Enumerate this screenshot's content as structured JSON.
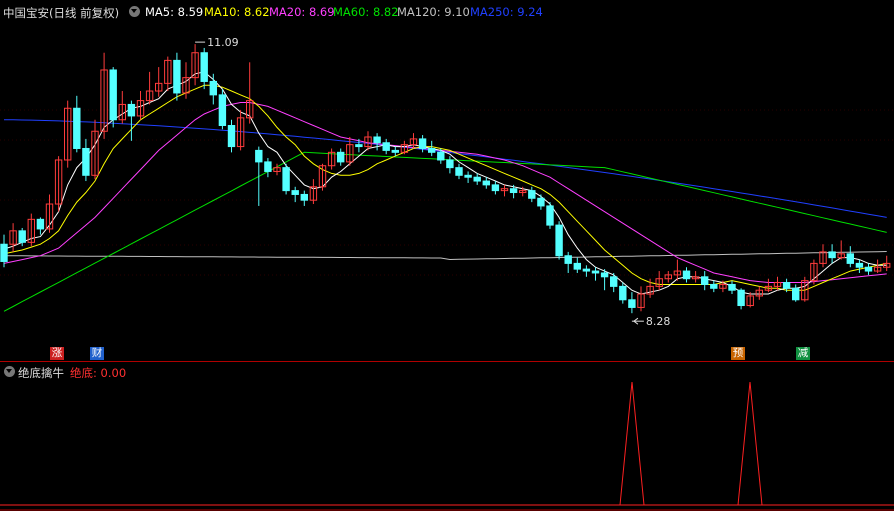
{
  "header": {
    "title": "中国宝安(日线 前复权)",
    "ma": [
      {
        "label": "MA5: 8.59",
        "color": "#ffffff"
      },
      {
        "label": "MA10: 8.62",
        "color": "#ffff00"
      },
      {
        "label": "MA20: 8.69",
        "color": "#ff40ff"
      },
      {
        "label": "MA60: 8.82",
        "color": "#00e000"
      },
      {
        "label": "MA120: 9.10",
        "color": "#c0c0c0"
      },
      {
        "label": "MA250: 9.24",
        "color": "#2040ff"
      }
    ]
  },
  "sub_header": {
    "name": "绝底擒牛",
    "series_label": "绝底: 0.00"
  },
  "tags": [
    {
      "text": "涨",
      "color": "#cc2020"
    },
    {
      "text": "财",
      "color": "#2060cc"
    },
    {
      "text": "预",
      "color": "#c86400"
    },
    {
      "text": "减",
      "color": "#109040"
    }
  ],
  "colors": {
    "up": "#ff3c3c",
    "down": "#54ffff",
    "axis": "#b00000",
    "grid": "#5a0000",
    "signal": "#ff2020"
  },
  "chart_data": {
    "type": "candlestick",
    "title": "中国宝安(日线 前复权)",
    "annotations": [
      {
        "text": "11.09",
        "type": "high"
      },
      {
        "text": "8.28",
        "type": "low"
      }
    ],
    "ylim": [
      8.0,
      11.3
    ],
    "candles": [
      [
        9.0,
        8.82,
        9.1,
        8.76
      ],
      [
        9.0,
        9.14,
        9.22,
        8.92
      ],
      [
        9.14,
        9.02,
        9.17,
        8.98
      ],
      [
        9.02,
        9.26,
        9.32,
        8.98
      ],
      [
        9.26,
        9.16,
        9.28,
        9.1
      ],
      [
        9.16,
        9.42,
        9.52,
        9.12
      ],
      [
        9.42,
        9.88,
        9.92,
        9.34
      ],
      [
        9.88,
        10.42,
        10.5,
        9.8
      ],
      [
        10.42,
        10.0,
        10.55,
        9.96
      ],
      [
        10.0,
        9.72,
        10.1,
        9.66
      ],
      [
        9.72,
        10.18,
        10.3,
        9.68
      ],
      [
        10.18,
        10.82,
        11.0,
        10.1
      ],
      [
        10.82,
        10.3,
        10.85,
        10.22
      ],
      [
        10.3,
        10.46,
        10.6,
        10.26
      ],
      [
        10.46,
        10.34,
        10.5,
        10.08
      ],
      [
        10.34,
        10.5,
        10.6,
        10.3
      ],
      [
        10.5,
        10.6,
        10.8,
        10.46
      ],
      [
        10.6,
        10.68,
        10.85,
        10.54
      ],
      [
        10.68,
        10.92,
        10.96,
        10.6
      ],
      [
        10.92,
        10.58,
        11.0,
        10.5
      ],
      [
        10.58,
        10.74,
        10.9,
        10.52
      ],
      [
        10.74,
        11.0,
        11.09,
        10.66
      ],
      [
        11.0,
        10.7,
        11.05,
        10.62
      ],
      [
        10.7,
        10.56,
        10.78,
        10.46
      ],
      [
        10.56,
        10.24,
        10.62,
        10.2
      ],
      [
        10.24,
        10.02,
        10.3,
        9.96
      ],
      [
        10.02,
        10.32,
        10.4,
        9.98
      ],
      [
        10.32,
        10.5,
        10.9,
        10.26
      ],
      [
        9.98,
        9.86,
        10.02,
        9.4
      ],
      [
        9.86,
        9.76,
        9.9,
        9.7
      ],
      [
        9.76,
        9.8,
        9.84,
        9.72
      ],
      [
        9.8,
        9.56,
        9.84,
        9.52
      ],
      [
        9.56,
        9.52,
        9.6,
        9.44
      ],
      [
        9.52,
        9.46,
        9.56,
        9.4
      ],
      [
        9.46,
        9.6,
        9.68,
        9.42
      ],
      [
        9.6,
        9.82,
        9.84,
        9.56
      ],
      [
        9.82,
        9.96,
        10.0,
        9.78
      ],
      [
        9.96,
        9.86,
        10.0,
        9.82
      ],
      [
        9.86,
        10.04,
        10.12,
        9.82
      ],
      [
        10.04,
        10.02,
        10.1,
        9.96
      ],
      [
        10.02,
        10.12,
        10.18,
        9.98
      ],
      [
        10.12,
        10.06,
        10.16,
        9.98
      ],
      [
        10.06,
        9.98,
        10.1,
        9.94
      ],
      [
        9.98,
        9.96,
        10.02,
        9.92
      ],
      [
        9.96,
        10.04,
        10.08,
        9.94
      ],
      [
        10.04,
        10.1,
        10.16,
        10.0
      ],
      [
        10.1,
        10.0,
        10.14,
        9.96
      ],
      [
        10.0,
        9.96,
        10.08,
        9.92
      ],
      [
        9.96,
        9.88,
        10.0,
        9.84
      ],
      [
        9.88,
        9.8,
        9.92,
        9.74
      ],
      [
        9.8,
        9.72,
        9.84,
        9.68
      ],
      [
        9.72,
        9.7,
        9.76,
        9.64
      ],
      [
        9.7,
        9.66,
        9.74,
        9.62
      ],
      [
        9.66,
        9.62,
        9.7,
        9.58
      ],
      [
        9.62,
        9.56,
        9.66,
        9.52
      ],
      [
        9.56,
        9.58,
        9.62,
        9.5
      ],
      [
        9.58,
        9.54,
        9.62,
        9.48
      ],
      [
        9.54,
        9.56,
        9.6,
        9.5
      ],
      [
        9.56,
        9.48,
        9.6,
        9.44
      ],
      [
        9.48,
        9.4,
        9.52,
        9.36
      ],
      [
        9.4,
        9.2,
        9.44,
        9.16
      ],
      [
        9.2,
        8.88,
        9.24,
        8.84
      ],
      [
        8.88,
        8.8,
        8.92,
        8.7
      ],
      [
        8.8,
        8.74,
        8.86,
        8.7
      ],
      [
        8.74,
        8.72,
        8.78,
        8.66
      ],
      [
        8.72,
        8.7,
        8.76,
        8.62
      ],
      [
        8.7,
        8.66,
        8.74,
        8.52
      ],
      [
        8.66,
        8.56,
        8.7,
        8.5
      ],
      [
        8.56,
        8.42,
        8.6,
        8.38
      ],
      [
        8.42,
        8.34,
        8.5,
        8.28
      ],
      [
        8.34,
        8.48,
        8.56,
        8.3
      ],
      [
        8.48,
        8.56,
        8.64,
        8.44
      ],
      [
        8.56,
        8.64,
        8.72,
        8.52
      ],
      [
        8.64,
        8.68,
        8.72,
        8.6
      ],
      [
        8.68,
        8.72,
        8.84,
        8.62
      ],
      [
        8.72,
        8.64,
        8.76,
        8.6
      ],
      [
        8.64,
        8.66,
        8.72,
        8.6
      ],
      [
        8.66,
        8.58,
        8.72,
        8.52
      ],
      [
        8.58,
        8.54,
        8.62,
        8.5
      ],
      [
        8.54,
        8.58,
        8.62,
        8.5
      ],
      [
        8.58,
        8.52,
        8.62,
        8.48
      ],
      [
        8.52,
        8.36,
        8.54,
        8.32
      ],
      [
        8.36,
        8.46,
        8.5,
        8.34
      ],
      [
        8.46,
        8.52,
        8.56,
        8.42
      ],
      [
        8.52,
        8.56,
        8.64,
        8.5
      ],
      [
        8.56,
        8.6,
        8.66,
        8.52
      ],
      [
        8.6,
        8.54,
        8.64,
        8.5
      ],
      [
        8.54,
        8.42,
        8.58,
        8.4
      ],
      [
        8.42,
        8.62,
        8.66,
        8.4
      ],
      [
        8.62,
        8.8,
        8.84,
        8.58
      ],
      [
        8.8,
        8.92,
        9.0,
        8.76
      ],
      [
        8.92,
        8.86,
        9.0,
        8.8
      ],
      [
        8.86,
        8.9,
        9.04,
        8.84
      ],
      [
        8.9,
        8.8,
        8.98,
        8.76
      ],
      [
        8.8,
        8.76,
        8.84,
        8.7
      ],
      [
        8.76,
        8.72,
        8.8,
        8.68
      ],
      [
        8.72,
        8.76,
        8.84,
        8.7
      ],
      [
        8.76,
        8.8,
        8.88,
        8.72
      ]
    ],
    "ma_series": [
      {
        "name": "MA5",
        "color": "#ffffff",
        "values": [
          8.95,
          8.98,
          9.02,
          9.06,
          9.08,
          9.2,
          9.34,
          9.62,
          9.8,
          9.9,
          10.04,
          10.22,
          10.3,
          10.36,
          10.42,
          10.44,
          10.48,
          10.52,
          10.62,
          10.66,
          10.7,
          10.78,
          10.8,
          10.72,
          10.62,
          10.46,
          10.38,
          10.34,
          10.16,
          10.02,
          9.96,
          9.82,
          9.72,
          9.62,
          9.58,
          9.6,
          9.7,
          9.76,
          9.84,
          9.92,
          10.0,
          10.02,
          10.04,
          10.02,
          10.02,
          10.04,
          10.02,
          10.0,
          9.98,
          9.94,
          9.86,
          9.8,
          9.74,
          9.7,
          9.66,
          9.62,
          9.6,
          9.58,
          9.56,
          9.5,
          9.42,
          9.28,
          9.1,
          8.96,
          8.84,
          8.76,
          8.72,
          8.68,
          8.6,
          8.52,
          8.48,
          8.5,
          8.52,
          8.56,
          8.64,
          8.66,
          8.66,
          8.64,
          8.62,
          8.6,
          8.56,
          8.5,
          8.48,
          8.48,
          8.48,
          8.52,
          8.54,
          8.54,
          8.56,
          8.64,
          8.72,
          8.8,
          8.86,
          8.86,
          8.84,
          8.8,
          8.78,
          8.78
        ]
      },
      {
        "name": "MA10",
        "color": "#ffff00",
        "values": [
          8.9,
          8.92,
          8.94,
          8.97,
          9.0,
          9.06,
          9.14,
          9.3,
          9.44,
          9.54,
          9.66,
          9.84,
          10.0,
          10.1,
          10.2,
          10.3,
          10.36,
          10.42,
          10.48,
          10.54,
          10.58,
          10.62,
          10.66,
          10.66,
          10.64,
          10.6,
          10.56,
          10.52,
          10.44,
          10.34,
          10.22,
          10.12,
          10.04,
          9.92,
          9.84,
          9.78,
          9.74,
          9.72,
          9.72,
          9.74,
          9.78,
          9.84,
          9.88,
          9.92,
          9.96,
          10.0,
          10.02,
          10.02,
          10.0,
          9.98,
          9.94,
          9.9,
          9.86,
          9.82,
          9.78,
          9.74,
          9.7,
          9.66,
          9.62,
          9.58,
          9.52,
          9.44,
          9.34,
          9.24,
          9.14,
          9.04,
          8.94,
          8.86,
          8.78,
          8.7,
          8.64,
          8.6,
          8.58,
          8.58,
          8.58,
          8.58,
          8.58,
          8.58,
          8.58,
          8.6,
          8.62,
          8.6,
          8.58,
          8.56,
          8.54,
          8.54,
          8.52,
          8.52,
          8.52,
          8.56,
          8.6,
          8.64,
          8.68,
          8.72,
          8.74,
          8.76,
          8.78,
          8.8
        ]
      },
      {
        "name": "MA20",
        "color": "#ff40ff",
        "values": [
          8.8,
          8.82,
          8.84,
          8.86,
          8.88,
          8.92,
          8.96,
          9.04,
          9.12,
          9.2,
          9.28,
          9.38,
          9.48,
          9.58,
          9.68,
          9.78,
          9.88,
          9.98,
          10.06,
          10.14,
          10.22,
          10.3,
          10.36,
          10.4,
          10.44,
          10.46,
          10.48,
          10.48,
          10.46,
          10.44,
          10.4,
          10.36,
          10.32,
          10.28,
          10.24,
          10.2,
          10.16,
          10.12,
          10.1,
          10.08,
          10.06,
          10.05,
          10.04,
          10.03,
          10.02,
          10.01,
          10.0,
          9.99,
          9.98,
          9.97,
          9.96,
          9.95,
          9.94,
          9.92,
          9.9,
          9.88,
          9.85,
          9.82,
          9.78,
          9.74,
          9.7,
          9.64,
          9.58,
          9.52,
          9.46,
          9.4,
          9.34,
          9.28,
          9.22,
          9.16,
          9.1,
          9.04,
          8.98,
          8.92,
          8.86,
          8.82,
          8.78,
          8.74,
          8.7,
          8.68,
          8.66,
          8.64,
          8.62,
          8.61,
          8.6,
          8.6,
          8.6,
          8.6,
          8.6,
          8.61,
          8.62,
          8.63,
          8.64,
          8.65,
          8.66,
          8.67,
          8.68,
          8.69
        ]
      }
    ],
    "ma60_endpoints": [
      [
        8.3,
        9.96
      ],
      [
        9.96,
        9.8
      ],
      [
        9.8,
        9.08
      ]
    ],
    "ma120_level": [
      8.88,
      8.82,
      9.1
    ],
    "ma250_endpoints": [
      10.3,
      9.28
    ],
    "indicator": {
      "name": "绝底擒牛",
      "series": [
        {
          "name": "绝底",
          "spikes_at": [
            72,
            81
          ],
          "value": 1
        }
      ]
    }
  }
}
